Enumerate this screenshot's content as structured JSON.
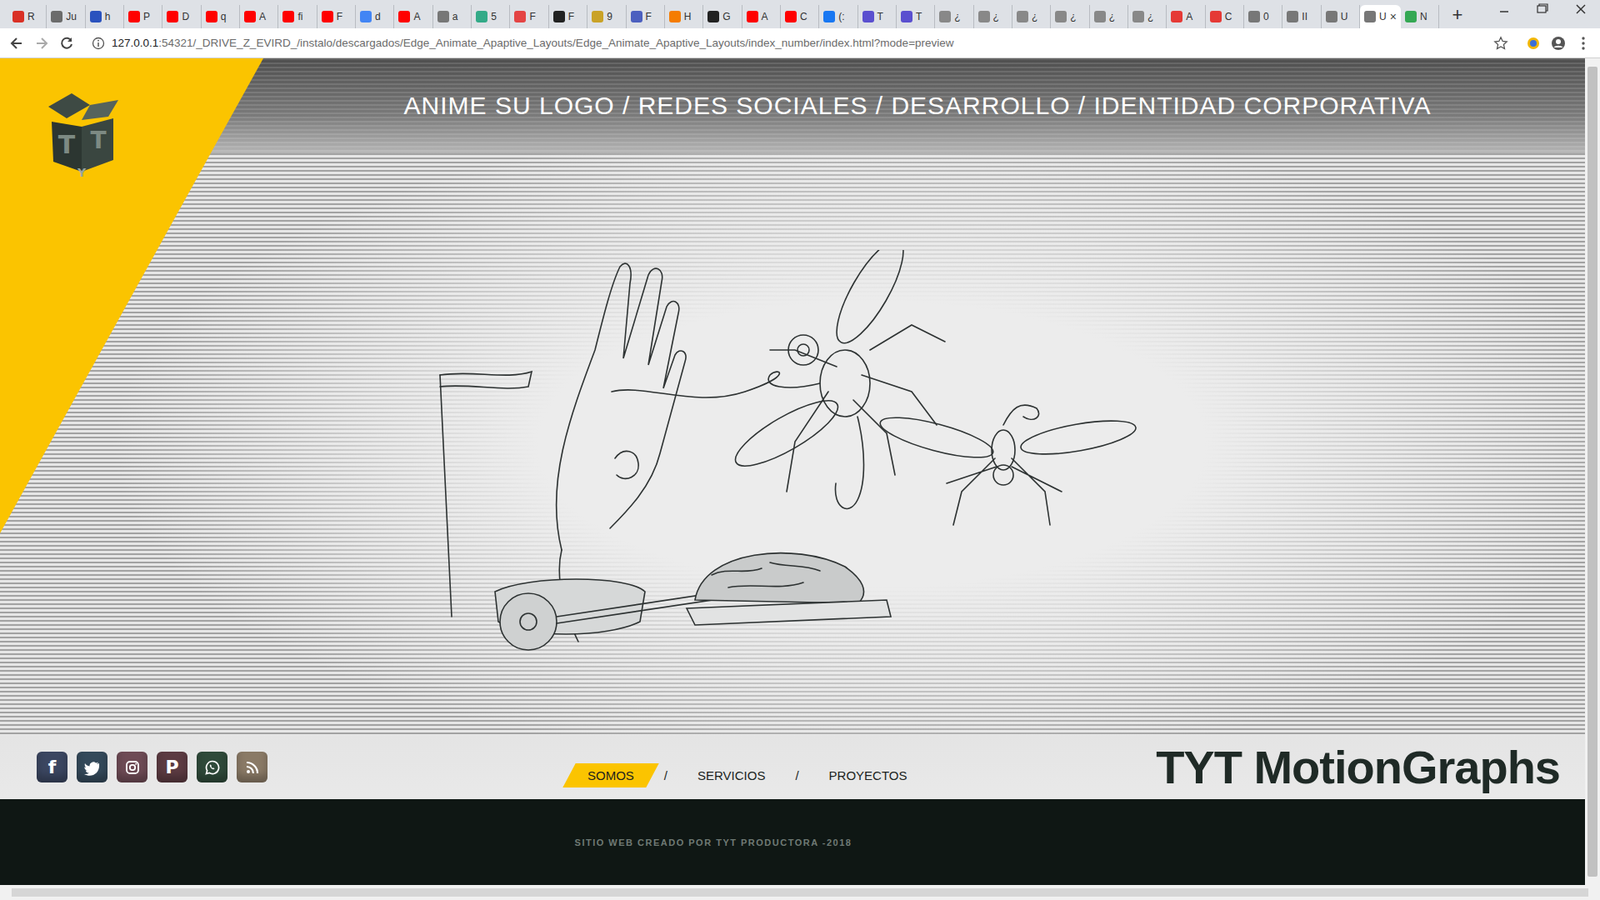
{
  "browser": {
    "tabs": [
      {
        "label": "R",
        "color": "#d93025",
        "selected": false
      },
      {
        "label": "Ju",
        "color": "#6b6b6b",
        "selected": false
      },
      {
        "label": "h",
        "color": "#2a52be",
        "selected": false
      },
      {
        "label": "P",
        "color": "#ff0000",
        "selected": false
      },
      {
        "label": "D",
        "color": "#ff0000",
        "selected": false
      },
      {
        "label": "q",
        "color": "#ff0000",
        "selected": false
      },
      {
        "label": "A",
        "color": "#ff0000",
        "selected": false
      },
      {
        "label": "fi",
        "color": "#ff0000",
        "selected": false
      },
      {
        "label": "F",
        "color": "#ff0000",
        "selected": false
      },
      {
        "label": "d",
        "color": "#4285f4",
        "selected": false
      },
      {
        "label": "A",
        "color": "#ff0000",
        "selected": false
      },
      {
        "label": "a",
        "color": "#777777",
        "selected": false
      },
      {
        "label": "5",
        "color": "#33aa88",
        "selected": false
      },
      {
        "label": "F",
        "color": "#e44444",
        "selected": false
      },
      {
        "label": "F",
        "color": "#222222",
        "selected": false
      },
      {
        "label": "9",
        "color": "#c9a227",
        "selected": false
      },
      {
        "label": "F",
        "color": "#4b5fbf",
        "selected": false
      },
      {
        "label": "H",
        "color": "#f57c00",
        "selected": false
      },
      {
        "label": "G",
        "color": "#222222",
        "selected": false
      },
      {
        "label": "A",
        "color": "#ff0000",
        "selected": false
      },
      {
        "label": "C",
        "color": "#ff0000",
        "selected": false
      },
      {
        "label": "(:",
        "color": "#1877f2",
        "selected": false
      },
      {
        "label": "T",
        "color": "#5a4fcf",
        "selected": false
      },
      {
        "label": "T",
        "color": "#5a4fcf",
        "selected": false
      },
      {
        "label": "¿",
        "color": "#888888",
        "selected": false
      },
      {
        "label": "¿",
        "color": "#888888",
        "selected": false
      },
      {
        "label": "¿",
        "color": "#888888",
        "selected": false
      },
      {
        "label": "¿",
        "color": "#888888",
        "selected": false
      },
      {
        "label": "¿",
        "color": "#888888",
        "selected": false
      },
      {
        "label": "¿",
        "color": "#888888",
        "selected": false
      },
      {
        "label": "A",
        "color": "#e53935",
        "selected": false
      },
      {
        "label": "C",
        "color": "#e53935",
        "selected": false
      },
      {
        "label": "0",
        "color": "#777777",
        "selected": false
      },
      {
        "label": "II",
        "color": "#777777",
        "selected": false
      },
      {
        "label": "U",
        "color": "#777777",
        "selected": false
      },
      {
        "label": "U",
        "color": "#777777",
        "selected": true
      },
      {
        "label": "N",
        "color": "#34a853",
        "selected": false
      }
    ],
    "close_tab": "×",
    "new_tab": "+",
    "address": {
      "host": "127.0.0.1",
      "rest": ":54321/_DRIVE_Z_EVIRD_/instalo/descargados/Edge_Animate_Apaptive_Layouts/Edge_Animate_Apaptive_Layouts/index_number/index.html?mode=preview"
    }
  },
  "page": {
    "logo_letters": [
      "T",
      "T",
      "Y"
    ],
    "tagline": "ANIME SU LOGO / REDES SOCIALES / DESARROLLO / IDENTIDAD CORPORATIVA",
    "social": [
      {
        "kind": "facebook",
        "glyph": "f",
        "color": "#3b4660"
      },
      {
        "kind": "twitter",
        "glyph": "",
        "color": "#34495a"
      },
      {
        "kind": "instagram",
        "glyph": "",
        "color": "#6e4b55"
      },
      {
        "kind": "pinterest",
        "glyph": "P",
        "color": "#5c3b42"
      },
      {
        "kind": "whatsapp",
        "glyph": "",
        "color": "#2f4a3a"
      },
      {
        "kind": "rss",
        "glyph": "",
        "color": "#8a7a66"
      }
    ],
    "nav": [
      {
        "label": "SOMOS",
        "selected": true
      },
      {
        "label": "SERVICIOS",
        "selected": false
      },
      {
        "label": "PROYECTOS",
        "selected": false
      }
    ],
    "nav_separator": "/",
    "brand": "TYT MotionGraphs",
    "footer": "SITIO WEB CREADO POR TYT PRODUCTORA -2018"
  }
}
